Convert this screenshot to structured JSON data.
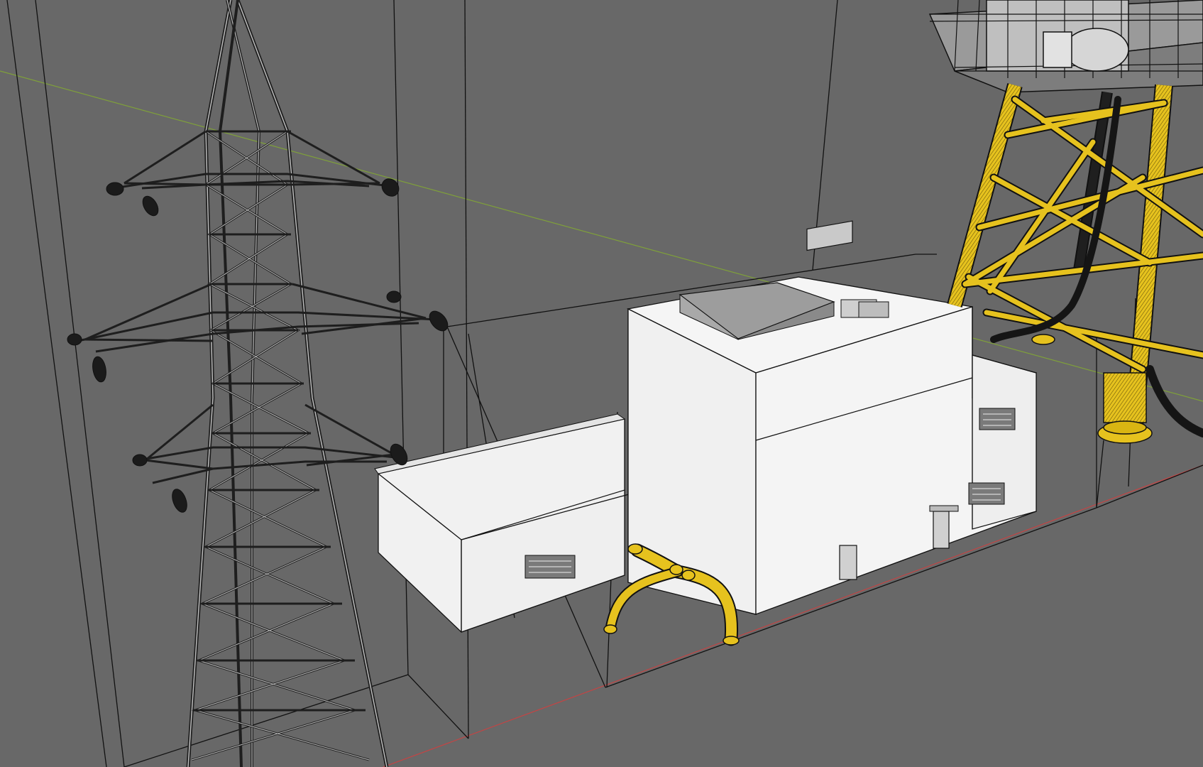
{
  "app": {
    "view": "3d-viewport",
    "shading": "solid-with-wireframe"
  },
  "colors": {
    "background": "#686868",
    "wire": "#111111",
    "building_face_light": "#f3f3f3",
    "building_face_mid": "#e6e6e6",
    "building_face_dark": "#d6d6d6",
    "selected_object": "#e6c21e",
    "axis_x": "#c24545",
    "axis_y": "#7fa03a",
    "tower_steel": "#2a2a2a"
  },
  "scene": {
    "objects": [
      {
        "name": "transmission-tower",
        "selected": false
      },
      {
        "name": "substation-building",
        "selected": false
      },
      {
        "name": "pipe-assembly",
        "selected": true
      },
      {
        "name": "offshore-jacket-platform",
        "selected": true
      }
    ]
  }
}
